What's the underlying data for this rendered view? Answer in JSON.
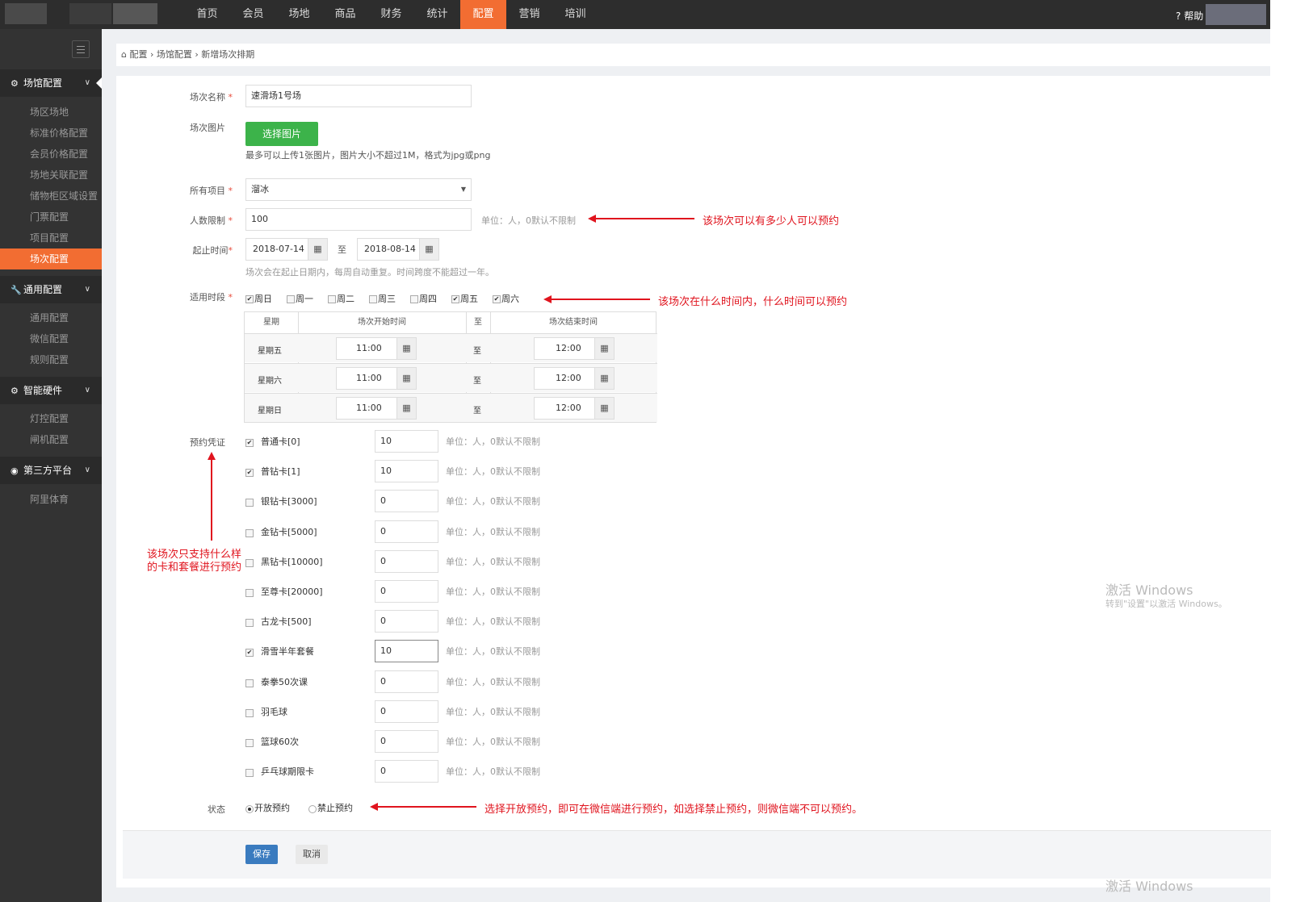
{
  "topnav": {
    "items": [
      "首页",
      "会员",
      "场地",
      "商品",
      "财务",
      "统计",
      "配置",
      "营销",
      "培训"
    ],
    "help": "帮助"
  },
  "sidebar": {
    "groups": [
      {
        "label": "场馆配置",
        "items": [
          "场区场地",
          "标准价格配置",
          "会员价格配置",
          "场地关联配置",
          "储物柜区域设置",
          "门票配置",
          "项目配置",
          "场次配置"
        ]
      },
      {
        "label": "通用配置",
        "items": [
          "通用配置",
          "微信配置",
          "规则配置"
        ]
      },
      {
        "label": "智能硬件",
        "items": [
          "灯控配置",
          "闸机配置"
        ]
      },
      {
        "label": "第三方平台",
        "items": [
          "阿里体育"
        ]
      }
    ]
  },
  "breadcrumb": {
    "home": "配置",
    "sep1": "›",
    "middle": "场馆配置",
    "sep2": "›",
    "current": "新增场次排期"
  },
  "form": {
    "name_label": "场次名称",
    "name_value": "速滑场1号场",
    "image_label": "场次图片",
    "image_button": "选择图片",
    "image_hint": "最多可以上传1张图片，图片大小不超过1M，格式为jpg或png",
    "project_label": "所有项目",
    "project_value": "溜冰",
    "limit_label": "人数限制",
    "limit_value": "100",
    "limit_hint": "单位：人，0默认不限制",
    "period_label": "起止时间",
    "start_date": "2018-07-14",
    "to": "至",
    "end_date": "2018-08-14",
    "period_hint": "场次会在起止日期内，每周自动重复。时间跨度不能超过一年。",
    "days_label": "适用时段",
    "days": [
      {
        "label": "周日",
        "checked": true
      },
      {
        "label": "周一",
        "checked": false
      },
      {
        "label": "周二",
        "checked": false
      },
      {
        "label": "周三",
        "checked": false
      },
      {
        "label": "周四",
        "checked": false
      },
      {
        "label": "周五",
        "checked": true
      },
      {
        "label": "周六",
        "checked": true
      }
    ],
    "table_headers": [
      "星期",
      "场次开始时间",
      "至",
      "场次结束时间"
    ],
    "rows": [
      {
        "day": "星期五",
        "start": "11:00",
        "to": "至",
        "end": "12:00"
      },
      {
        "day": "星期六",
        "start": "11:00",
        "to": "至",
        "end": "12:00"
      },
      {
        "day": "星期日",
        "start": "11:00",
        "to": "至",
        "end": "12:00"
      }
    ],
    "cred_label": "预约凭证",
    "cards": [
      {
        "name": "普通卡[0]",
        "checked": true,
        "value": "10"
      },
      {
        "name": "普钻卡[1]",
        "checked": true,
        "value": "10"
      },
      {
        "name": "银钻卡[3000]",
        "checked": false,
        "value": "0"
      },
      {
        "name": "金钻卡[5000]",
        "checked": false,
        "value": "0"
      },
      {
        "name": "黑钻卡[10000]",
        "checked": false,
        "value": "0"
      },
      {
        "name": "至尊卡[20000]",
        "checked": false,
        "value": "0"
      },
      {
        "name": "古龙卡[500]",
        "checked": false,
        "value": "0"
      },
      {
        "name": "滑雪半年套餐",
        "checked": true,
        "value": "10"
      },
      {
        "name": "泰拳50次课",
        "checked": false,
        "value": "0"
      },
      {
        "name": "羽毛球",
        "checked": false,
        "value": "0"
      },
      {
        "name": "篮球60次",
        "checked": false,
        "value": "0"
      },
      {
        "name": "乒乓球期限卡",
        "checked": false,
        "value": "0"
      }
    ],
    "card_hint": "单位：人，0默认不限制",
    "status_label": "状态",
    "status_open": "开放预约",
    "status_closed": "禁止预约",
    "save": "保存",
    "cancel": "取消"
  },
  "annotations": {
    "limit": "该场次可以有多少人可以预约",
    "days": "该场次在什么时间内，什么时间可以预约",
    "cards_line1": "该场次只支持什么样",
    "cards_line2": "的卡和套餐进行预约",
    "status": "选择开放预约，即可在微信端进行预约，如选择禁止预约，则微信端不可以预约。"
  },
  "watermark": {
    "title": "激活 Windows",
    "sub": "转到\"设置\"以激活 Windows。"
  },
  "colors": {
    "accent": "#f26d32",
    "green": "#3cb34a",
    "blue": "#3a7bbf",
    "annotation": "#e0141e"
  }
}
